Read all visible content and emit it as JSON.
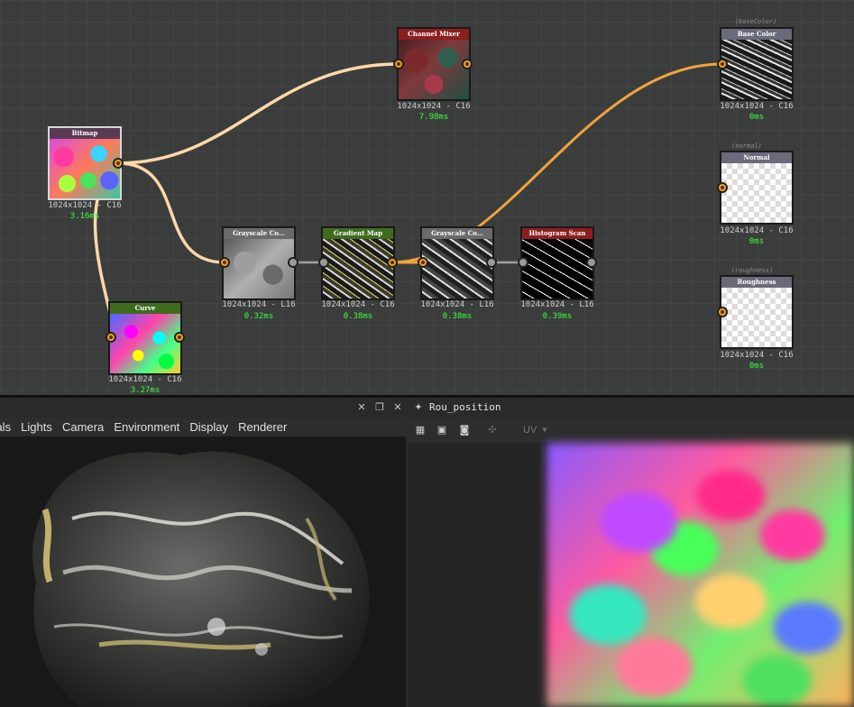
{
  "graph": {
    "nodes": [
      {
        "id": "bitmap",
        "title": "Bitmap",
        "info": "1024x1024 - C16",
        "time": "3.16ms",
        "header_color": "#5a3b55",
        "thumb": "bitmap"
      },
      {
        "id": "channel-mixer",
        "title": "Channel Mixer",
        "info": "1024x1024 - C16",
        "time": "7.98ms",
        "header_color": "#8b1e1e",
        "thumb": "channel"
      },
      {
        "id": "curve",
        "title": "Curve",
        "info": "1024x1024 - C16",
        "time": "3.27ms",
        "header_color": "#3f6b1f",
        "thumb": "curve"
      },
      {
        "id": "grayscale-1",
        "title": "Grayscale Co…",
        "info": "1024x1024 - L16",
        "time": "0.32ms",
        "header_color": "#6a6a6a",
        "thumb": "gray"
      },
      {
        "id": "gradient-map",
        "title": "Gradient Map",
        "info": "1024x1024 - C16",
        "time": "0.38ms",
        "header_color": "#3f6b1f",
        "thumb": "gradient"
      },
      {
        "id": "grayscale-2",
        "title": "Grayscale Co…",
        "info": "1024x1024 - L16",
        "time": "0.38ms",
        "header_color": "#6a6a6a",
        "thumb": "gray2"
      },
      {
        "id": "histogram-scan",
        "title": "Histogram Scan",
        "info": "1024x1024 - L16",
        "time": "0.39ms",
        "header_color": "#8b1e1e",
        "thumb": "hist"
      },
      {
        "id": "basecolor-output",
        "title": "Base Color",
        "info": "1024x1024 - C16",
        "time": "0ms",
        "header_color": "#6a6a7a",
        "thumb": "base",
        "output_label": "(baseColor)"
      },
      {
        "id": "normal-output",
        "title": "Normal",
        "info": "1024x1024 - C16",
        "time": "0ms",
        "header_color": "#6a6a7a",
        "thumb": "checker",
        "output_label": "(normal)"
      },
      {
        "id": "roughness-output",
        "title": "Roughness",
        "info": "1024x1024 - C16",
        "time": "0ms",
        "header_color": "#6a6a7a",
        "thumb": "checker",
        "output_label": "(roughness)"
      }
    ],
    "colors": {
      "wire_light": "#ffd8a8",
      "wire_orange": "#f0a43a",
      "wire_grey": "#a0a0a0",
      "time_green": "#3cff3c"
    }
  },
  "viewport3d": {
    "menu": [
      "erials",
      "Lights",
      "Camera",
      "Environment",
      "Display",
      "Renderer"
    ],
    "controls": [
      "pin-icon",
      "restore-icon",
      "close-icon"
    ]
  },
  "viewport2d": {
    "title": "Rou_position",
    "toolbar": {
      "uv_label": "UV"
    }
  }
}
